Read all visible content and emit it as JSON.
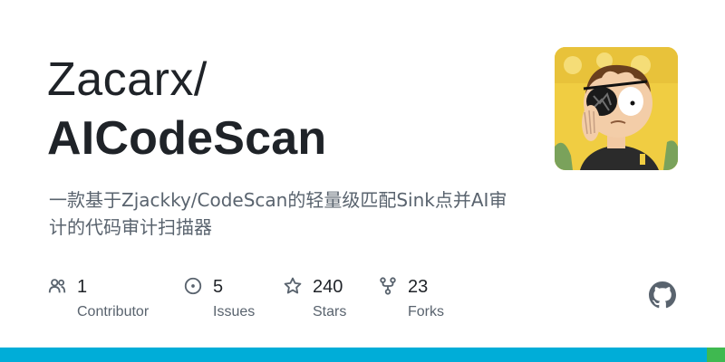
{
  "repo_card": {
    "owner": "Zacarx/",
    "name": "AICodeScan",
    "description": "一款基于Zjackky/CodeScan的轻量级匹配Sink点并AI审计的代码审计扫描器"
  },
  "stats": [
    {
      "icon": "people-icon",
      "count": "1",
      "label": "Contributor"
    },
    {
      "icon": "issue-icon",
      "count": "5",
      "label": "Issues"
    },
    {
      "icon": "star-icon",
      "count": "240",
      "label": "Stars"
    },
    {
      "icon": "fork-icon",
      "count": "23",
      "label": "Forks"
    }
  ],
  "icons": {
    "brand": "github-mark-icon",
    "avatar": "cartoon-character-avatar"
  },
  "language_bar": [
    {
      "color": "#00add8",
      "share": 0.975
    },
    {
      "color": "#3fb950",
      "share": 0.025
    }
  ],
  "colors": {
    "text_primary": "#1f2328",
    "text_secondary": "#59636e",
    "icon": "#59636e"
  }
}
